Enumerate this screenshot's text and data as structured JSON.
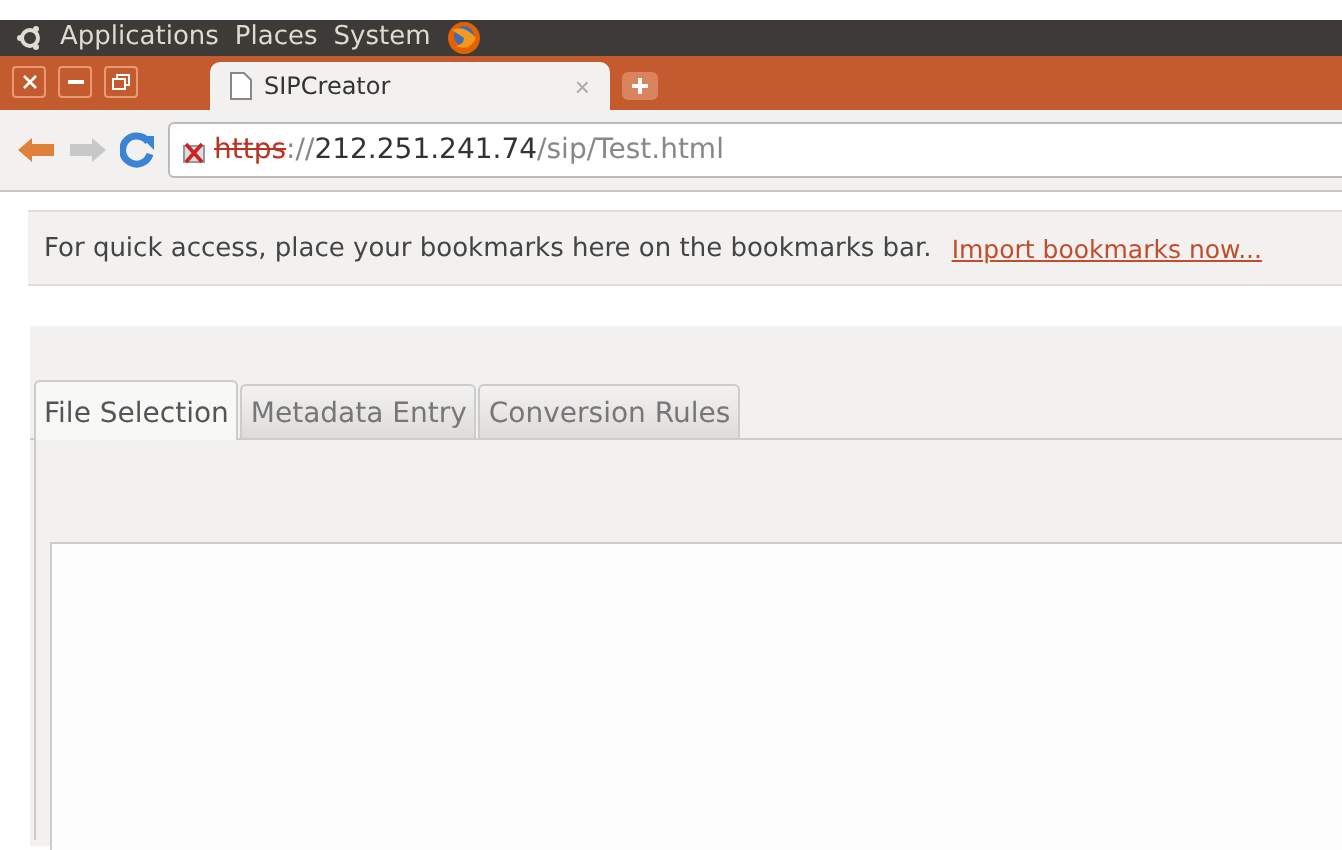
{
  "panel": {
    "menus": [
      "Applications",
      "Places",
      "System"
    ]
  },
  "browser_tab": {
    "title": "SIPCreator",
    "close": "×"
  },
  "address_bar": {
    "scheme": "https",
    "separator": "://",
    "host": "212.251.241.74",
    "path": "/sip/Test.html",
    "insecure": true
  },
  "bookmarks_bar": {
    "message": "For quick access, place your bookmarks here on the bookmarks bar.",
    "link": "Import bookmarks now..."
  },
  "tabs": [
    {
      "label": "File Selection",
      "selected": true
    },
    {
      "label": "Metadata Entry",
      "selected": false
    },
    {
      "label": "Conversion Rules",
      "selected": false
    }
  ]
}
